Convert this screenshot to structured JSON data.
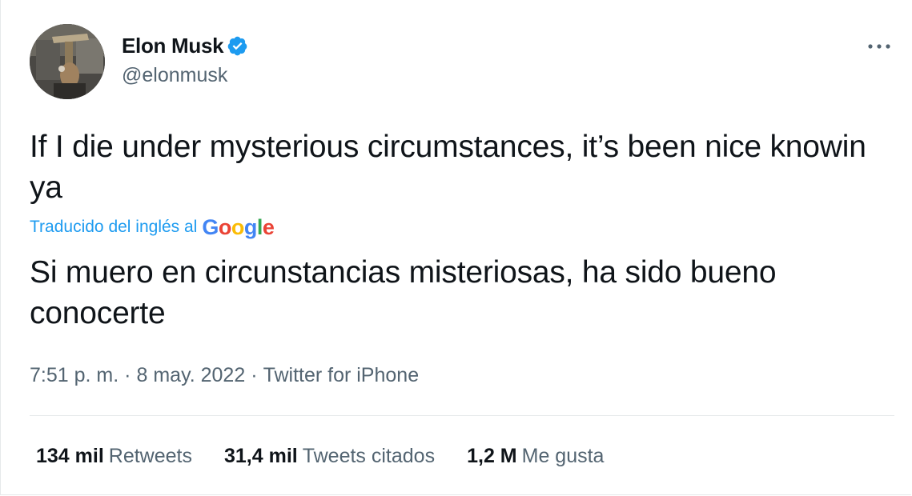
{
  "author": {
    "display_name": "Elon Musk",
    "handle": "@elonmusk",
    "verified_icon": "verified-badge-icon",
    "avatar_icon": "avatar-photo"
  },
  "header": {
    "more_icon": "more-options-icon"
  },
  "tweet": {
    "text": "If I die under mysterious circumstances, it’s been nice knowin ya",
    "translation_label": "Traducido del inglés al",
    "translation_provider": "Google",
    "translated_text": "Si muero en circunstancias misteriosas, ha sido bueno conocerte"
  },
  "meta": {
    "time": "7:51 p. m.",
    "separator": "·",
    "date": "8 may. 2022",
    "source": "Twitter for iPhone"
  },
  "stats": [
    {
      "count": "134 mil",
      "label": "Retweets"
    },
    {
      "count": "31,4 mil",
      "label": "Tweets citados"
    },
    {
      "count": "1,2 M",
      "label": "Me gusta"
    }
  ],
  "colors": {
    "text_primary": "#0f1419",
    "text_secondary": "#536471",
    "accent": "#1d9bf0",
    "divider": "#e6e9ea"
  }
}
